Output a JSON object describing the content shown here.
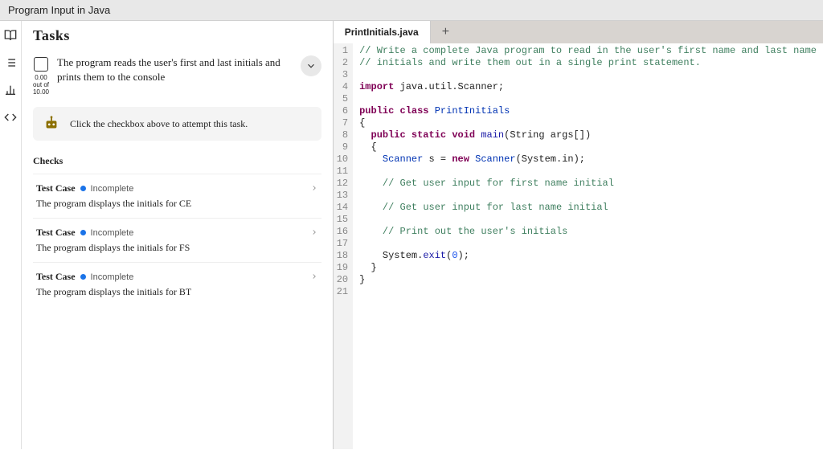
{
  "header": {
    "title": "Program Input in Java"
  },
  "sidebar": {
    "icons": [
      "book-icon",
      "list-icon",
      "chart-icon",
      "code-icon"
    ]
  },
  "tasks": {
    "title": "Tasks",
    "score_top": "0.00",
    "score_mid": "out of",
    "score_bot": "10.00",
    "description": "The program reads the user's first and last initials and prints them to the console",
    "hint": "Click the checkbox above to attempt this task.",
    "checks_title": "Checks",
    "checks": [
      {
        "label": "Test Case",
        "status": "Incomplete",
        "desc": "The program displays the initials for CE"
      },
      {
        "label": "Test Case",
        "status": "Incomplete",
        "desc": "The program displays the initials for FS"
      },
      {
        "label": "Test Case",
        "status": "Incomplete",
        "desc": "The program displays the initials for BT"
      }
    ]
  },
  "editor": {
    "tab": "PrintInitials.java",
    "lines": [
      {
        "n": 1,
        "html": "<span class='cm'>// Write a complete Java program to read in the user's first name and last name</span>"
      },
      {
        "n": 2,
        "html": "<span class='cm'>// initials and write them out in a single print statement.</span>"
      },
      {
        "n": 3,
        "html": ""
      },
      {
        "n": 4,
        "html": "<span class='pkw'>import</span> java.util.Scanner;"
      },
      {
        "n": 5,
        "html": ""
      },
      {
        "n": 6,
        "html": "<span class='pkw'>public class</span> <span class='cls'>PrintInitials</span>"
      },
      {
        "n": 7,
        "html": "{"
      },
      {
        "n": 8,
        "html": "  <span class='pkw'>public static void</span> <span class='fn'>main</span>(String args[])"
      },
      {
        "n": 9,
        "html": "  {"
      },
      {
        "n": 10,
        "html": "    <span class='cls'>Scanner</span> s = <span class='pkw'>new</span> <span class='cls'>Scanner</span>(System.in);"
      },
      {
        "n": 11,
        "html": ""
      },
      {
        "n": 12,
        "html": "    <span class='cm'>// Get user input for first name initial</span>"
      },
      {
        "n": 13,
        "html": ""
      },
      {
        "n": 14,
        "html": "    <span class='cm'>// Get user input for last name initial</span>"
      },
      {
        "n": 15,
        "html": ""
      },
      {
        "n": 16,
        "html": "    <span class='cm'>// Print out the user's initials</span>"
      },
      {
        "n": 17,
        "html": ""
      },
      {
        "n": 18,
        "html": "    System.<span class='fn'>exit</span>(<span class='num'>0</span>);"
      },
      {
        "n": 19,
        "html": "  }"
      },
      {
        "n": 20,
        "html": "}"
      },
      {
        "n": 21,
        "html": ""
      }
    ]
  }
}
